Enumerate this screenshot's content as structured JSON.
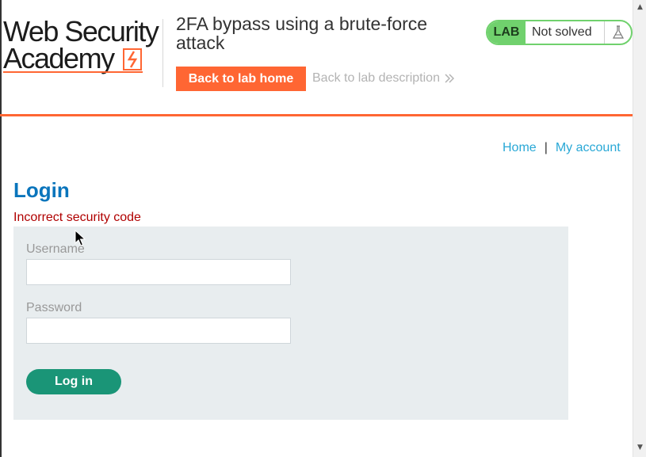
{
  "header": {
    "logo_line1": "Web Security",
    "logo_line2": "Academy",
    "lab_title": "2FA bypass using a brute-force attack",
    "back_home_label": "Back to lab home",
    "back_description_label": "Back to lab description",
    "lab_tag": "LAB",
    "lab_status": "Not solved"
  },
  "nav": {
    "home_label": "Home",
    "separator": "|",
    "account_label": "My account"
  },
  "main": {
    "title": "Login",
    "error": "Incorrect security code",
    "form": {
      "username_label": "Username",
      "username_value": "",
      "password_label": "Password",
      "password_value": "",
      "submit_label": "Log in"
    }
  },
  "colors": {
    "accent": "#ff6633",
    "lab_green": "#70d16d",
    "title_blue": "#0a75bc",
    "link_blue": "#29a8d6",
    "error_red": "#b00000",
    "submit_green": "#1a9577"
  },
  "icons": {
    "logo_mark": "lightning-bolt-icon",
    "back_chevron": "double-chevron-right-icon",
    "lab_flask": "flask-icon",
    "scroll_up": "triangle-up-icon",
    "scroll_down": "triangle-down-icon"
  }
}
